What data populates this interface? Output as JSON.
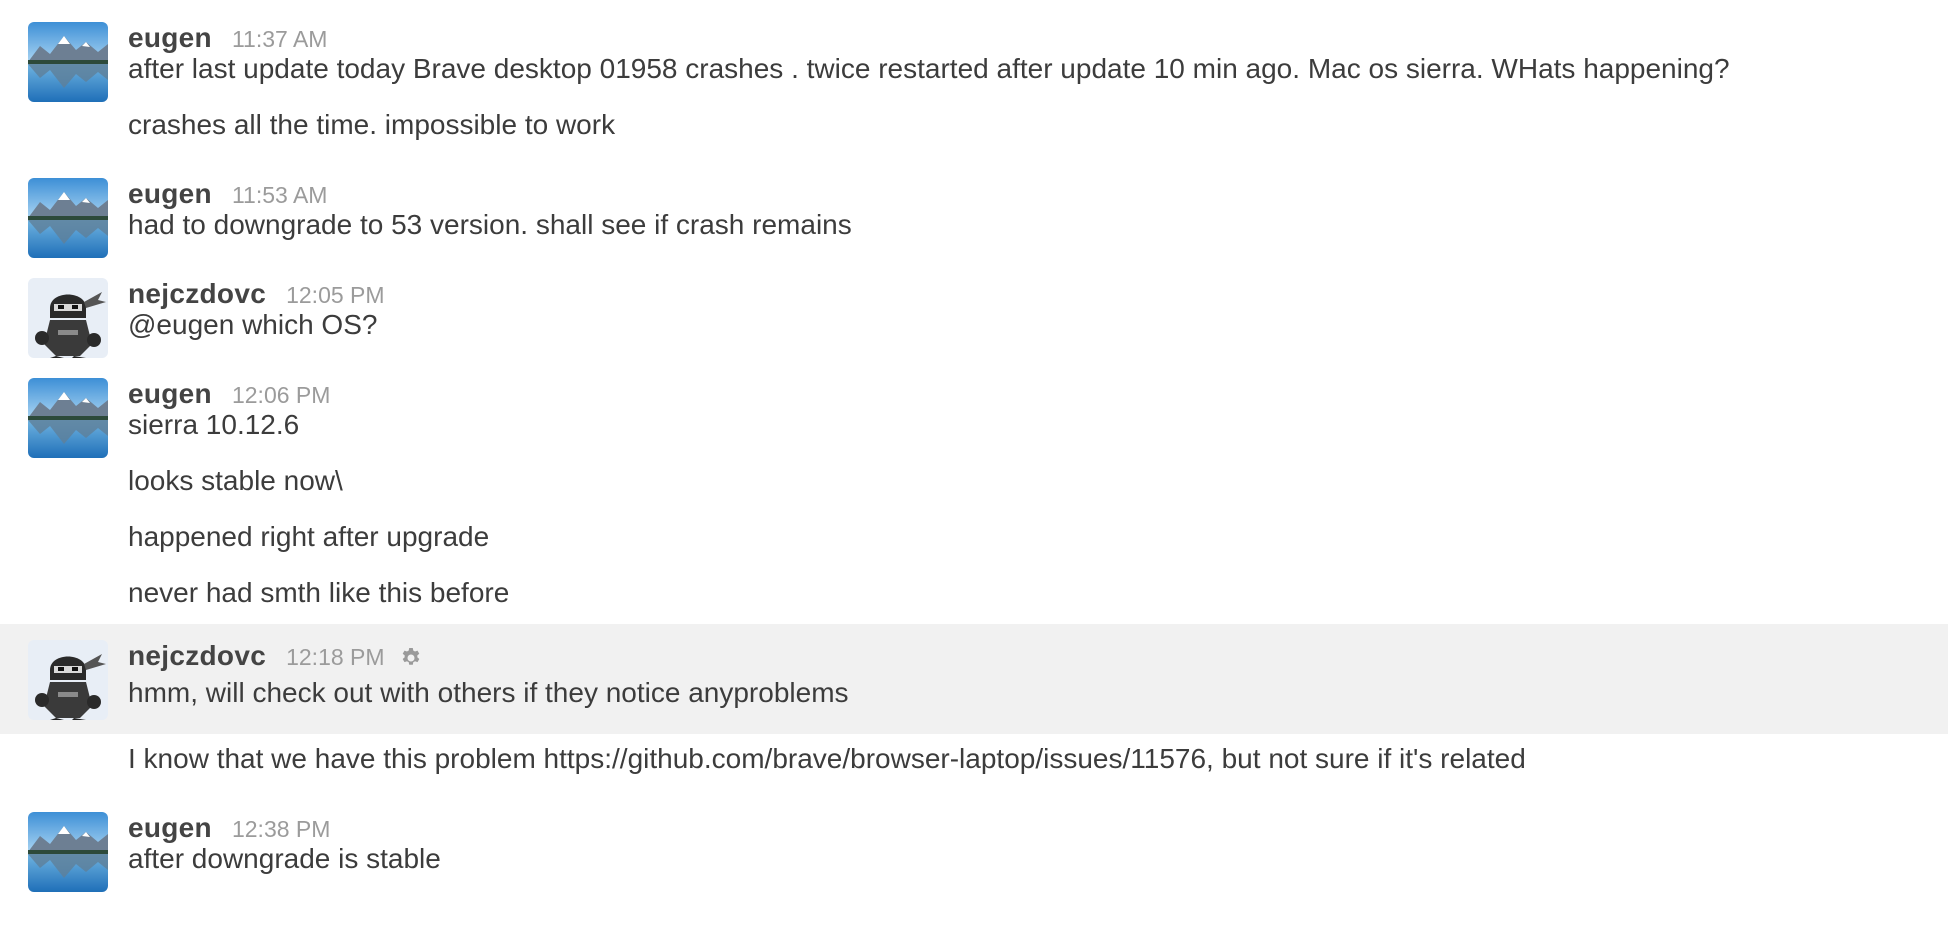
{
  "messages": [
    {
      "user": "eugen",
      "avatar": "mountain-lake-avatar",
      "time": "11:37 AM",
      "lines": [
        "after last update today Brave desktop 01958 crashes . twice restarted after update 10 min ago. Mac os sierra. WHats happening?",
        "crashes all the time. impossible to work"
      ]
    },
    {
      "user": "eugen",
      "avatar": "mountain-lake-avatar",
      "time": "11:53 AM",
      "lines": [
        "had to downgrade to 53 version. shall see if crash remains"
      ]
    },
    {
      "user": "nejczdovc",
      "avatar": "ninja-avatar",
      "time": "12:05 PM",
      "lines": [
        "@eugen which OS?"
      ]
    },
    {
      "user": "eugen",
      "avatar": "mountain-lake-avatar",
      "time": "12:06 PM",
      "lines": [
        "sierra 10.12.6",
        "looks stable now\\",
        "happened right after upgrade",
        "never had smth like this before"
      ]
    },
    {
      "user": "nejczdovc",
      "avatar": "ninja-avatar",
      "time": "12:18 PM",
      "has_settings_icon": true,
      "highlighted": true,
      "lines": [
        "hmm, will check out with others if they notice anyproblems",
        "I know that we have this problem https://github.com/brave/browser-laptop/issues/11576, but not sure if it's related"
      ]
    },
    {
      "user": "eugen",
      "avatar": "mountain-lake-avatar",
      "time": "12:38 PM",
      "lines": [
        "after downgrade is stable"
      ]
    }
  ],
  "colors": {
    "username": "#444444",
    "timestamp": "#9b9b9b",
    "text": "#3c3c3c",
    "highlight": "#f1f1f1"
  }
}
